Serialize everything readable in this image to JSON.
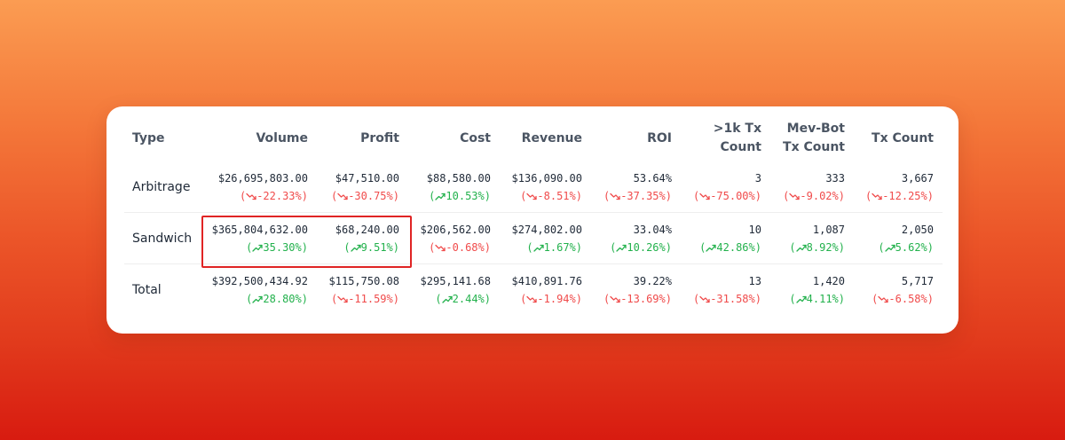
{
  "columns": [
    "Type",
    "Volume",
    "Profit",
    "Cost",
    "Revenue",
    "ROI",
    ">1k Tx\nCount",
    "Mev-Bot\nTx Count",
    "Tx Count"
  ],
  "rows": [
    {
      "type": "Arbitrage",
      "cells": [
        {
          "value": "$26,695,803.00",
          "change": "-22.33%",
          "direction": "down"
        },
        {
          "value": "$47,510.00",
          "change": "-30.75%",
          "direction": "down"
        },
        {
          "value": "$88,580.00",
          "change": "10.53%",
          "direction": "up"
        },
        {
          "value": "$136,090.00",
          "change": "-8.51%",
          "direction": "down"
        },
        {
          "value": "53.64%",
          "change": "-37.35%",
          "direction": "down"
        },
        {
          "value": "3",
          "change": "-75.00%",
          "direction": "down"
        },
        {
          "value": "333",
          "change": "-9.02%",
          "direction": "down"
        },
        {
          "value": "3,667",
          "change": "-12.25%",
          "direction": "down"
        }
      ]
    },
    {
      "type": "Sandwich",
      "cells": [
        {
          "value": "$365,804,632.00",
          "change": "35.30%",
          "direction": "up"
        },
        {
          "value": "$68,240.00",
          "change": "9.51%",
          "direction": "up"
        },
        {
          "value": "$206,562.00",
          "change": "-0.68%",
          "direction": "down"
        },
        {
          "value": "$274,802.00",
          "change": "1.67%",
          "direction": "up"
        },
        {
          "value": "33.04%",
          "change": "10.26%",
          "direction": "up"
        },
        {
          "value": "10",
          "change": "42.86%",
          "direction": "up"
        },
        {
          "value": "1,087",
          "change": "8.92%",
          "direction": "up"
        },
        {
          "value": "2,050",
          "change": "5.62%",
          "direction": "up"
        }
      ]
    },
    {
      "type": "Total",
      "cells": [
        {
          "value": "$392,500,434.92",
          "change": "28.80%",
          "direction": "up"
        },
        {
          "value": "$115,750.08",
          "change": "-11.59%",
          "direction": "down"
        },
        {
          "value": "$295,141.68",
          "change": "2.44%",
          "direction": "up"
        },
        {
          "value": "$410,891.76",
          "change": "-1.94%",
          "direction": "down"
        },
        {
          "value": "39.22%",
          "change": "-13.69%",
          "direction": "down"
        },
        {
          "value": "13",
          "change": "-31.58%",
          "direction": "down"
        },
        {
          "value": "1,420",
          "change": "4.11%",
          "direction": "up"
        },
        {
          "value": "5,717",
          "change": "-6.58%",
          "direction": "down"
        }
      ]
    }
  ],
  "colors": {
    "positive": "#22b14c",
    "negative": "#f04b4b",
    "highlight": "#e02424"
  },
  "icons": {
    "up": "trend-up-icon",
    "down": "trend-down-icon"
  }
}
